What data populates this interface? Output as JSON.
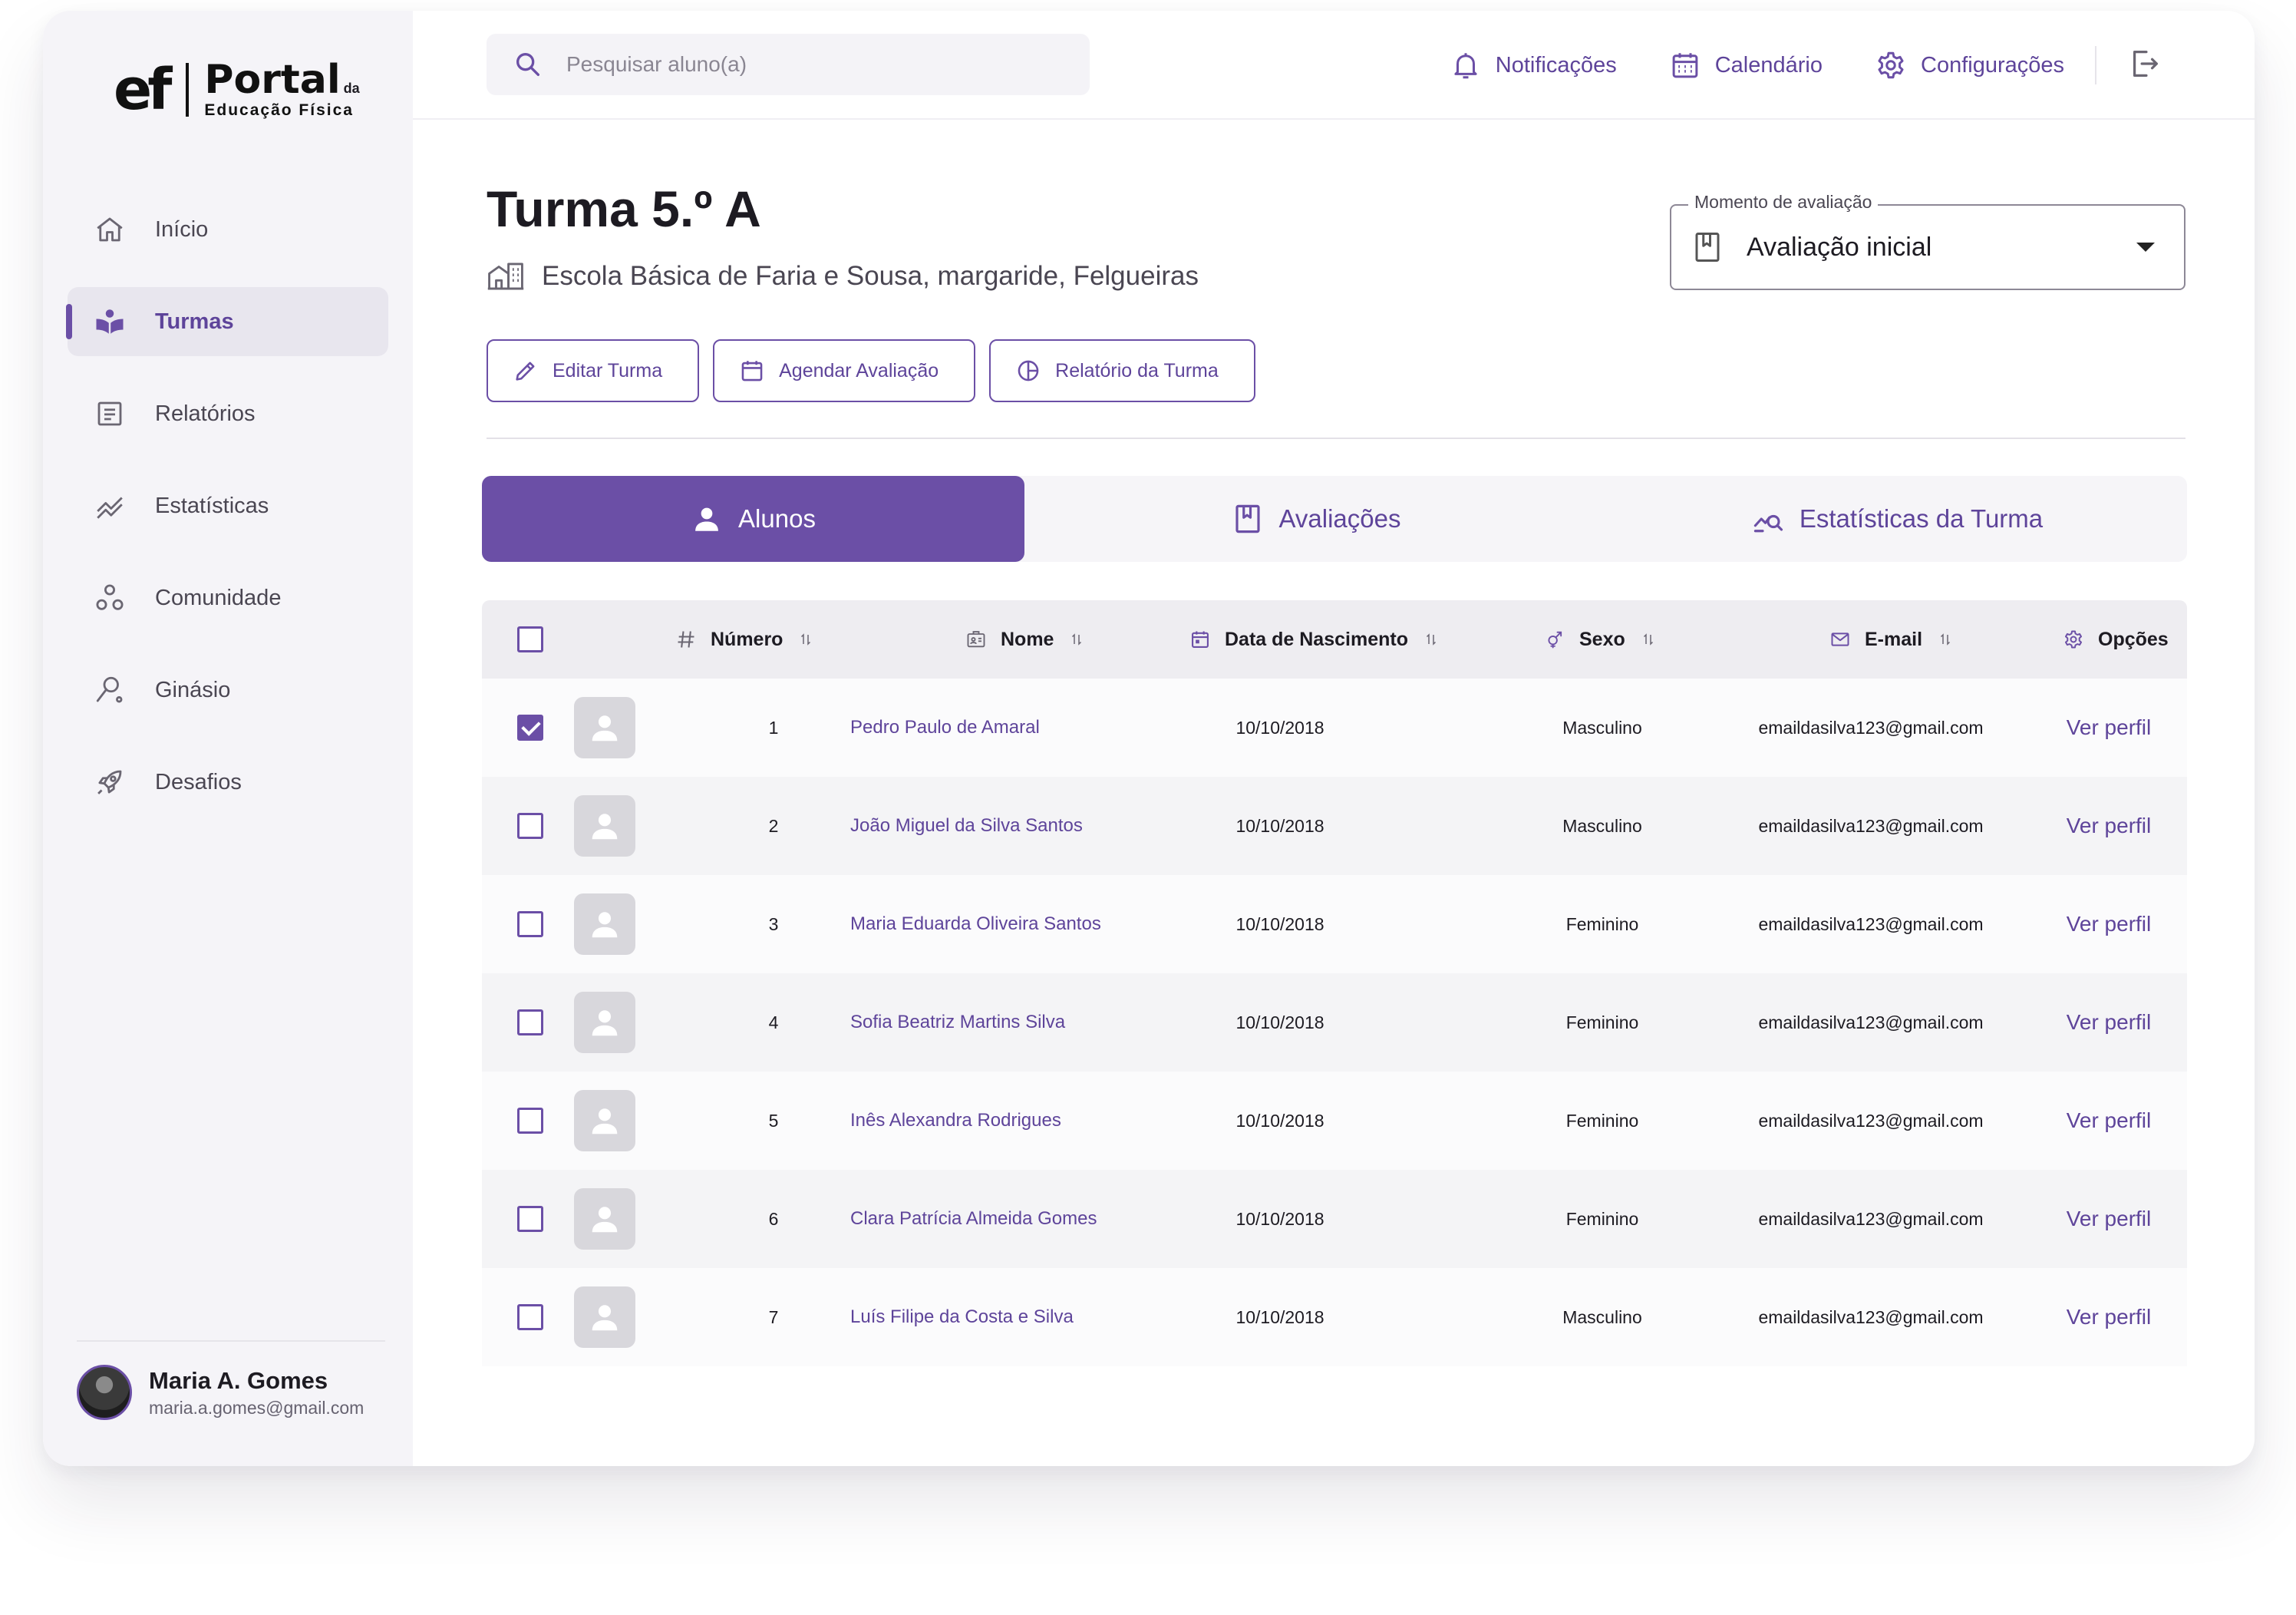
{
  "brand": {
    "mark": "ef",
    "name": "Portal",
    "da": "da",
    "subtitle": "Educação Física"
  },
  "nav": [
    {
      "label": "Início",
      "icon": "home-icon",
      "active": false
    },
    {
      "label": "Turmas",
      "icon": "book-reader-icon",
      "active": true
    },
    {
      "label": "Relatórios",
      "icon": "report-icon",
      "active": false
    },
    {
      "label": "Estatísticas",
      "icon": "trend-icon",
      "active": false
    },
    {
      "label": "Comunidade",
      "icon": "community-icon",
      "active": false
    },
    {
      "label": "Ginásio",
      "icon": "gym-icon",
      "active": false
    },
    {
      "label": "Desafios",
      "icon": "rocket-icon",
      "active": false
    }
  ],
  "user": {
    "name": "Maria A. Gomes",
    "email": "maria.a.gomes@gmail.com"
  },
  "search": {
    "placeholder": "Pesquisar aluno(a)"
  },
  "topbar": {
    "notifications": "Notificações",
    "calendar": "Calendário",
    "settings": "Configurações"
  },
  "page": {
    "title": "Turma 5.º A",
    "school": "Escola Básica de Faria e Sousa, margaride, Felgueiras"
  },
  "moment": {
    "legend": "Momento de avaliação",
    "value": "Avaliação inicial"
  },
  "actions": {
    "edit": "Editar Turma",
    "schedule": "Agendar Avaliação",
    "report": "Relatório da Turma"
  },
  "tabs": [
    {
      "label": "Alunos",
      "active": true
    },
    {
      "label": "Avaliações",
      "active": false
    },
    {
      "label": "Estatísticas da Turma",
      "active": false
    }
  ],
  "table": {
    "headers": {
      "number": "Número",
      "name": "Nome",
      "birth": "Data de Nascimento",
      "sex": "Sexo",
      "email": "E-mail",
      "options": "Opções"
    },
    "view_label": "Ver perfil",
    "rows": [
      {
        "num": "1",
        "name": "Pedro Paulo de Amaral",
        "birth": "10/10/2018",
        "sex": "Masculino",
        "email": "emaildasilva123@gmail.com",
        "checked": true
      },
      {
        "num": "2",
        "name": "João Miguel da Silva Santos",
        "birth": "10/10/2018",
        "sex": "Masculino",
        "email": "emaildasilva123@gmail.com",
        "checked": false
      },
      {
        "num": "3",
        "name": "Maria Eduarda Oliveira Santos",
        "birth": "10/10/2018",
        "sex": "Feminino",
        "email": "emaildasilva123@gmail.com",
        "checked": false
      },
      {
        "num": "4",
        "name": "Sofia Beatriz Martins Silva",
        "birth": "10/10/2018",
        "sex": "Feminino",
        "email": "emaildasilva123@gmail.com",
        "checked": false
      },
      {
        "num": "5",
        "name": "Inês Alexandra Rodrigues",
        "birth": "10/10/2018",
        "sex": "Feminino",
        "email": "emaildasilva123@gmail.com",
        "checked": false
      },
      {
        "num": "6",
        "name": "Clara Patrícia Almeida Gomes",
        "birth": "10/10/2018",
        "sex": "Feminino",
        "email": "emaildasilva123@gmail.com",
        "checked": false
      },
      {
        "num": "7",
        "name": "Luís Filipe da Costa e Silva",
        "birth": "10/10/2018",
        "sex": "Masculino",
        "email": "emaildasilva123@gmail.com",
        "checked": false
      }
    ]
  },
  "colors": {
    "accent": "#6b4fa6",
    "accent_text": "#5e449a",
    "sidebar_bg": "#f5f4f8"
  }
}
